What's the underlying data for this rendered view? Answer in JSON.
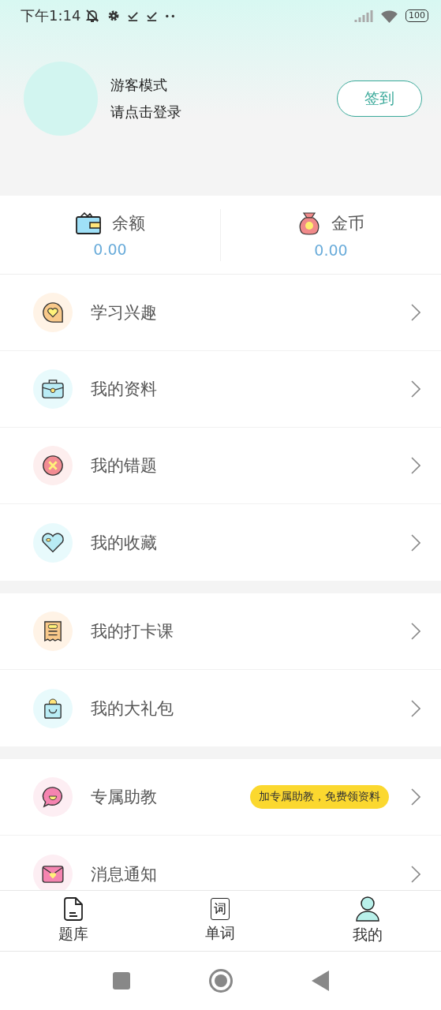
{
  "status_bar": {
    "time": "下午1:14",
    "battery": "100"
  },
  "profile": {
    "name": "游客模式",
    "hint": "请点击登录",
    "sign_in": "签到"
  },
  "stats": [
    {
      "kind": "wallet",
      "label": "余额",
      "value": "0.00"
    },
    {
      "kind": "coin",
      "label": "金币",
      "value": "0.00"
    }
  ],
  "groups": [
    [
      {
        "kind": "interest",
        "label": "学习兴趣"
      },
      {
        "kind": "folder",
        "label": "我的资料"
      },
      {
        "kind": "wrong",
        "label": "我的错题"
      },
      {
        "kind": "favorite",
        "label": "我的收藏"
      }
    ],
    [
      {
        "kind": "checkin",
        "label": "我的打卡课"
      },
      {
        "kind": "gift",
        "label": "我的大礼包"
      }
    ],
    [
      {
        "kind": "assistant",
        "label": "专属助教",
        "badge": "加专属助教，免费领资料"
      },
      {
        "kind": "message",
        "label": "消息通知"
      }
    ]
  ],
  "tabs": [
    {
      "kind": "doc",
      "label": "题库",
      "selected": false
    },
    {
      "kind": "word",
      "label": "单词",
      "glyph": "词",
      "selected": false
    },
    {
      "kind": "person",
      "label": "我的",
      "selected": true
    }
  ]
}
